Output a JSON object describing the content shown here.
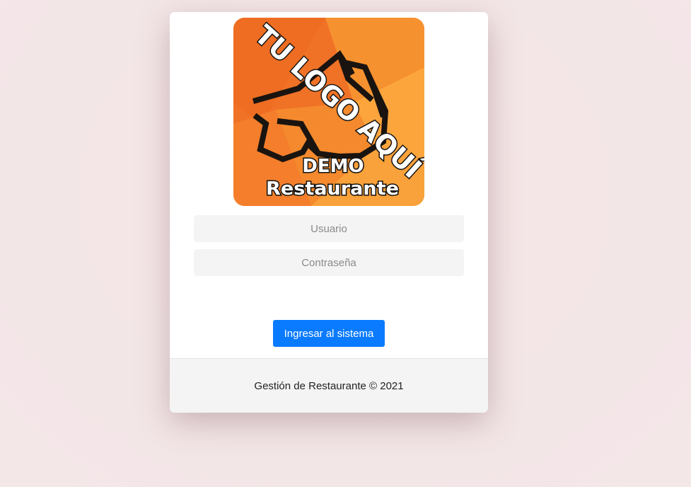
{
  "logo": {
    "headline": "TU LOGO AQUÍ",
    "line1": "DEMO",
    "line2": "Restaurante",
    "icon": "fox-head-outline",
    "colors": {
      "background": "#f07a2a",
      "accent": "#f9a23c",
      "outline": "#1a1410"
    }
  },
  "form": {
    "username_placeholder": "Usuario",
    "username_value": "",
    "password_placeholder": "Contraseña",
    "password_value": "",
    "submit_label": "Ingresar al sistema"
  },
  "footer": {
    "text": "Gestión de Restaurante © 2021"
  },
  "colors": {
    "primary": "#0a7bff",
    "card": "#ffffff",
    "input_bg": "#f4f4f4",
    "page_bg": "#f5e6e7"
  }
}
